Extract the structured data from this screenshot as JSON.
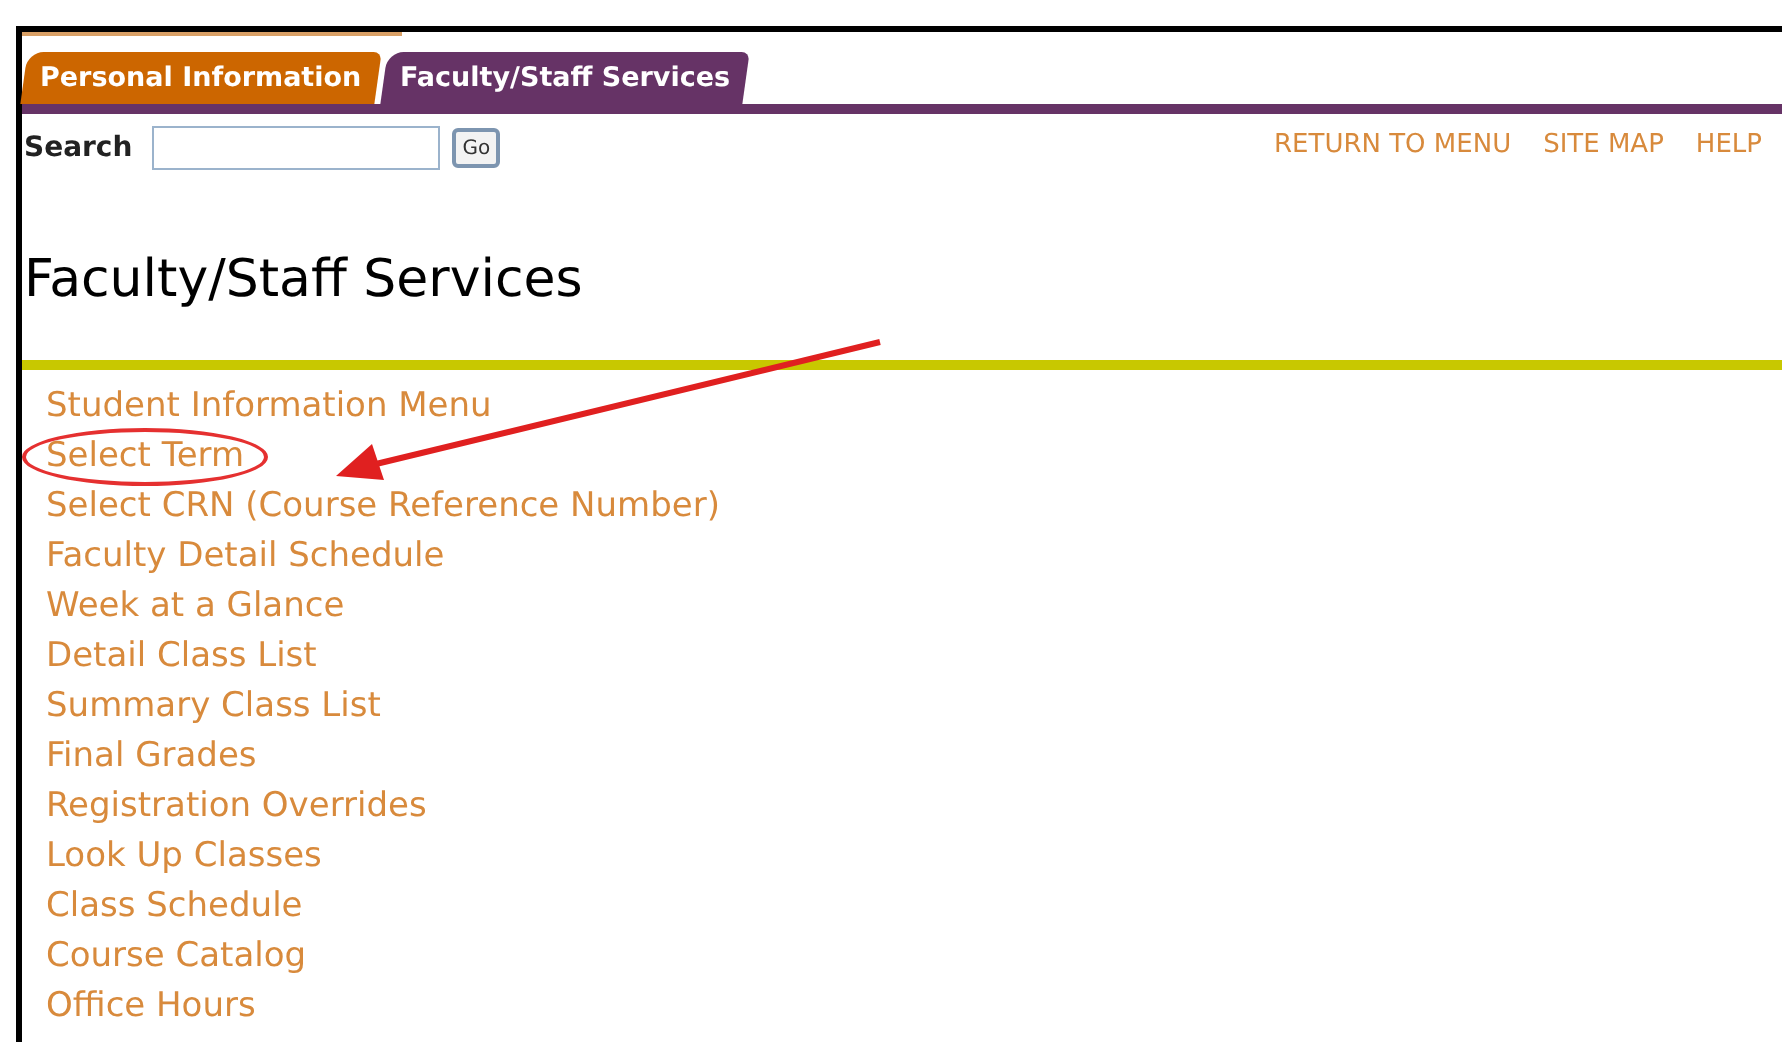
{
  "tabs": [
    {
      "label": "Personal Information",
      "selected": false
    },
    {
      "label": "Faculty/Staff Services",
      "selected": true
    }
  ],
  "search": {
    "label": "Search",
    "button": "Go"
  },
  "top_links": [
    "RETURN TO MENU",
    "SITE MAP",
    "HELP"
  ],
  "title": "Faculty/Staff Services",
  "menu": [
    {
      "label": "Student Information Menu",
      "circled": false
    },
    {
      "label": "Select Term",
      "circled": true
    },
    {
      "label": "Select CRN (Course Reference Number)",
      "circled": false
    },
    {
      "label": "Faculty Detail Schedule",
      "circled": false
    },
    {
      "label": "Week at a Glance",
      "circled": false
    },
    {
      "label": "Detail Class List",
      "circled": false
    },
    {
      "label": "Summary Class List",
      "circled": false
    },
    {
      "label": "Final Grades",
      "circled": false
    },
    {
      "label": "Registration Overrides",
      "circled": false
    },
    {
      "label": "Look Up Classes",
      "circled": false
    },
    {
      "label": "Class Schedule",
      "circled": false
    },
    {
      "label": "Course Catalog",
      "circled": false
    },
    {
      "label": "Office Hours",
      "circled": false
    }
  ]
}
